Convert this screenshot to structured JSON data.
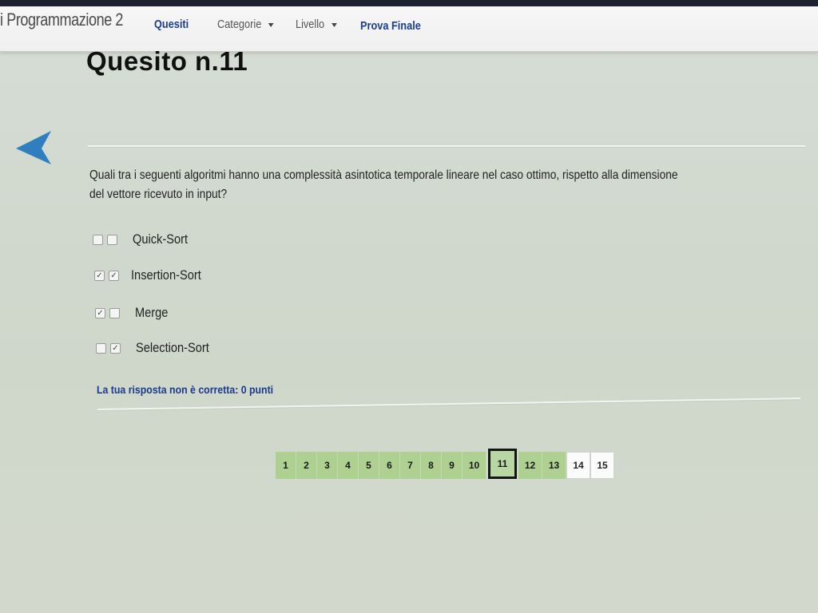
{
  "navbar": {
    "brand": "i Programmazione 2",
    "items": [
      {
        "label": "Quesiti",
        "active": true
      },
      {
        "label": "Categorie",
        "dropdown": true
      },
      {
        "label": "Livello",
        "dropdown": true
      },
      {
        "label": "Prova Finale",
        "active": true
      }
    ]
  },
  "page": {
    "title": "Quesito n.11",
    "back_icon": "back-arrow-icon",
    "question": "Quali tra i seguenti algoritmi hanno una complessità asintotica temporale lineare nel caso ottimo, rispetto alla dimensione del vettore ricevuto in input?",
    "options": [
      {
        "label": "Quick-Sort",
        "expected": false,
        "selected": false
      },
      {
        "label": "Insertion-Sort",
        "expected": true,
        "selected": true
      },
      {
        "label": "Merge",
        "expected": true,
        "selected": false
      },
      {
        "label": "Selection-Sort",
        "expected": false,
        "selected": true
      }
    ],
    "feedback": "La tua risposta non è corretta: 0 punti"
  },
  "pagination": {
    "pages": [
      "1",
      "2",
      "3",
      "4",
      "5",
      "6",
      "7",
      "8",
      "9",
      "10",
      "11",
      "12",
      "13",
      "14",
      "15"
    ],
    "current": "11",
    "answered_color": "#aed192",
    "unanswered_color": "#fbfbfb"
  },
  "colors": {
    "accent": "#1d3d8f",
    "back_arrow": "#2f7fc0"
  }
}
